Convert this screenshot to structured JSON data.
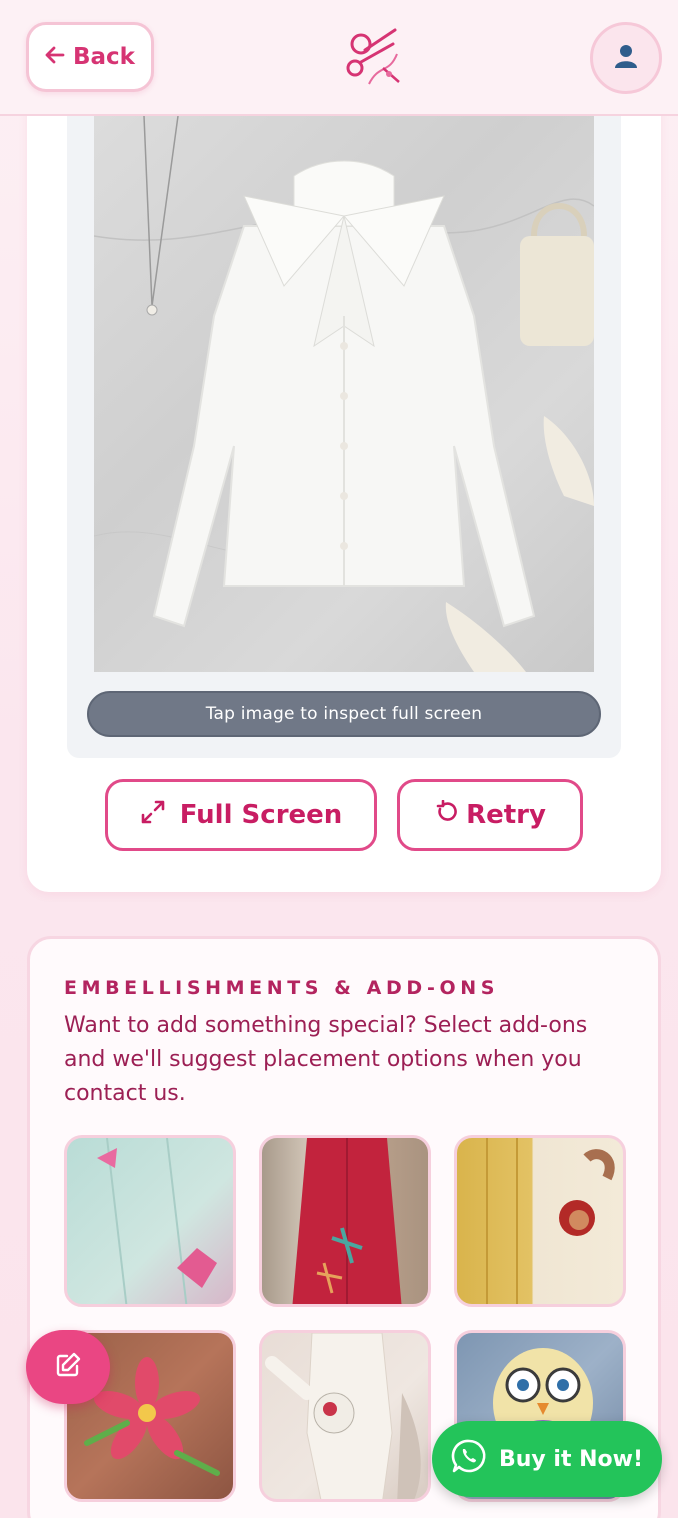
{
  "header": {
    "back_label": "Back",
    "logo_icon": "scissors-needle-logo",
    "avatar_icon": "user-icon"
  },
  "preview": {
    "tap_hint": "Tap image to inspect full screen",
    "fullscreen_label": "Full Screen",
    "retry_label": "Retry"
  },
  "addons": {
    "title": "EMBELLISHMENTS & ADD-ONS",
    "description": "Want to add something special? Select add-ons and we'll suggest placement options when you contact us.",
    "items": [
      {
        "icon": "bird-embroidery-shirt"
      },
      {
        "icon": "dragonfly-embroidery-dress"
      },
      {
        "icon": "face-patch-trousers"
      },
      {
        "icon": "flower-beaded-top"
      },
      {
        "icon": "floral-patch-suit"
      },
      {
        "icon": "owl-beaded-patch"
      }
    ]
  },
  "actions": {
    "buy_label": "Buy it Now!",
    "edit_icon": "edit-icon"
  },
  "colors": {
    "accent": "#d63473",
    "whatsapp": "#23c45a",
    "hint_bg": "#707887"
  }
}
